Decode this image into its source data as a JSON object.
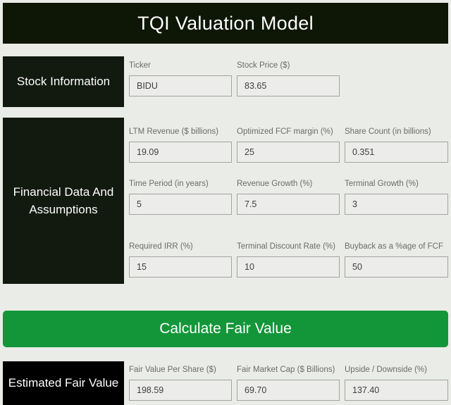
{
  "header": {
    "title": "TQI Valuation Model",
    "background": "#0e1606",
    "text_color": "#ffffff"
  },
  "sections": {
    "stock_information": {
      "label": "Stock Information",
      "fields": [
        {
          "label": "Ticker",
          "value": "BIDU"
        },
        {
          "label": "Stock Price ($)",
          "value": "83.65"
        }
      ]
    },
    "financial_data": {
      "label": "Financial Data And Assumptions",
      "fields": [
        {
          "label": "LTM Revenue ($ billions)",
          "value": "19.09"
        },
        {
          "label": "Optimized FCF margin (%)",
          "value": "25"
        },
        {
          "label": "Share Count (in billions)",
          "value": "0.351"
        },
        {
          "label": "Time Period (in years)",
          "value": "5"
        },
        {
          "label": "Revenue Growth (%)",
          "value": "7.5"
        },
        {
          "label": "Terminal Growth (%)",
          "value": "3"
        },
        {
          "label": "Required IRR (%)",
          "value": "15"
        },
        {
          "label": "Terminal Discount Rate (%)",
          "value": "10"
        },
        {
          "label": "Buyback as a %age of FCF",
          "value": "50"
        }
      ]
    },
    "estimated_fair_value": {
      "label": "Estimated Fair Value",
      "fields": [
        {
          "label": "Fair Value Per Share ($)",
          "value": "198.59"
        },
        {
          "label": "Fair Market Cap ($ Billions)",
          "value": "69.70"
        },
        {
          "label": "Upside / Downside (%)",
          "value": "137.40"
        }
      ]
    }
  },
  "actions": {
    "calculate_label": "Calculate Fair Value",
    "calculate_color": "#13963a"
  },
  "theme": {
    "page_background": "#eaece7",
    "dark_block": "#12190e",
    "black_block": "#000000",
    "label_text": "#6c6c6c",
    "input_text": "#3f3f3f",
    "input_background": "#ecedea",
    "input_border": "#a3a3a3"
  }
}
